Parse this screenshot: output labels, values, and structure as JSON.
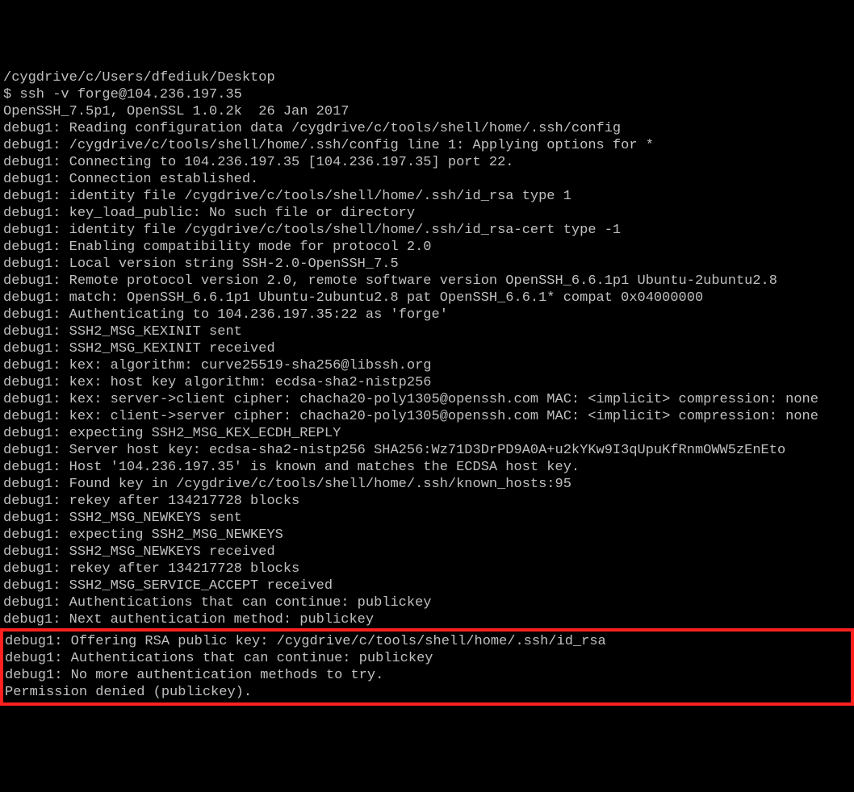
{
  "terminal": {
    "cwd": "/cygdrive/c/Users/dfediuk/Desktop",
    "prompt": "$ ",
    "command": "ssh -v forge@104.236.197.35",
    "lines": [
      "OpenSSH_7.5p1, OpenSSL 1.0.2k  26 Jan 2017",
      "debug1: Reading configuration data /cygdrive/c/tools/shell/home/.ssh/config",
      "debug1: /cygdrive/c/tools/shell/home/.ssh/config line 1: Applying options for *",
      "debug1: Connecting to 104.236.197.35 [104.236.197.35] port 22.",
      "debug1: Connection established.",
      "debug1: identity file /cygdrive/c/tools/shell/home/.ssh/id_rsa type 1",
      "debug1: key_load_public: No such file or directory",
      "debug1: identity file /cygdrive/c/tools/shell/home/.ssh/id_rsa-cert type -1",
      "debug1: Enabling compatibility mode for protocol 2.0",
      "debug1: Local version string SSH-2.0-OpenSSH_7.5",
      "debug1: Remote protocol version 2.0, remote software version OpenSSH_6.6.1p1 Ubuntu-2ubuntu2.8",
      "debug1: match: OpenSSH_6.6.1p1 Ubuntu-2ubuntu2.8 pat OpenSSH_6.6.1* compat 0x04000000",
      "debug1: Authenticating to 104.236.197.35:22 as 'forge'",
      "debug1: SSH2_MSG_KEXINIT sent",
      "debug1: SSH2_MSG_KEXINIT received",
      "debug1: kex: algorithm: curve25519-sha256@libssh.org",
      "debug1: kex: host key algorithm: ecdsa-sha2-nistp256",
      "debug1: kex: server->client cipher: chacha20-poly1305@openssh.com MAC: <implicit> compression: none",
      "debug1: kex: client->server cipher: chacha20-poly1305@openssh.com MAC: <implicit> compression: none",
      "debug1: expecting SSH2_MSG_KEX_ECDH_REPLY",
      "debug1: Server host key: ecdsa-sha2-nistp256 SHA256:Wz71D3DrPD9A0A+u2kYKw9I3qUpuKfRnmOWW5zEnEto",
      "debug1: Host '104.236.197.35' is known and matches the ECDSA host key.",
      "debug1: Found key in /cygdrive/c/tools/shell/home/.ssh/known_hosts:95",
      "debug1: rekey after 134217728 blocks",
      "debug1: SSH2_MSG_NEWKEYS sent",
      "debug1: expecting SSH2_MSG_NEWKEYS",
      "debug1: SSH2_MSG_NEWKEYS received",
      "debug1: rekey after 134217728 blocks",
      "debug1: SSH2_MSG_SERVICE_ACCEPT received",
      "debug1: Authentications that can continue: publickey",
      "debug1: Next authentication method: publickey"
    ],
    "highlighted_lines": [
      "debug1: Offering RSA public key: /cygdrive/c/tools/shell/home/.ssh/id_rsa",
      "debug1: Authentications that can continue: publickey",
      "debug1: No more authentication methods to try.",
      "Permission denied (publickey)."
    ]
  }
}
